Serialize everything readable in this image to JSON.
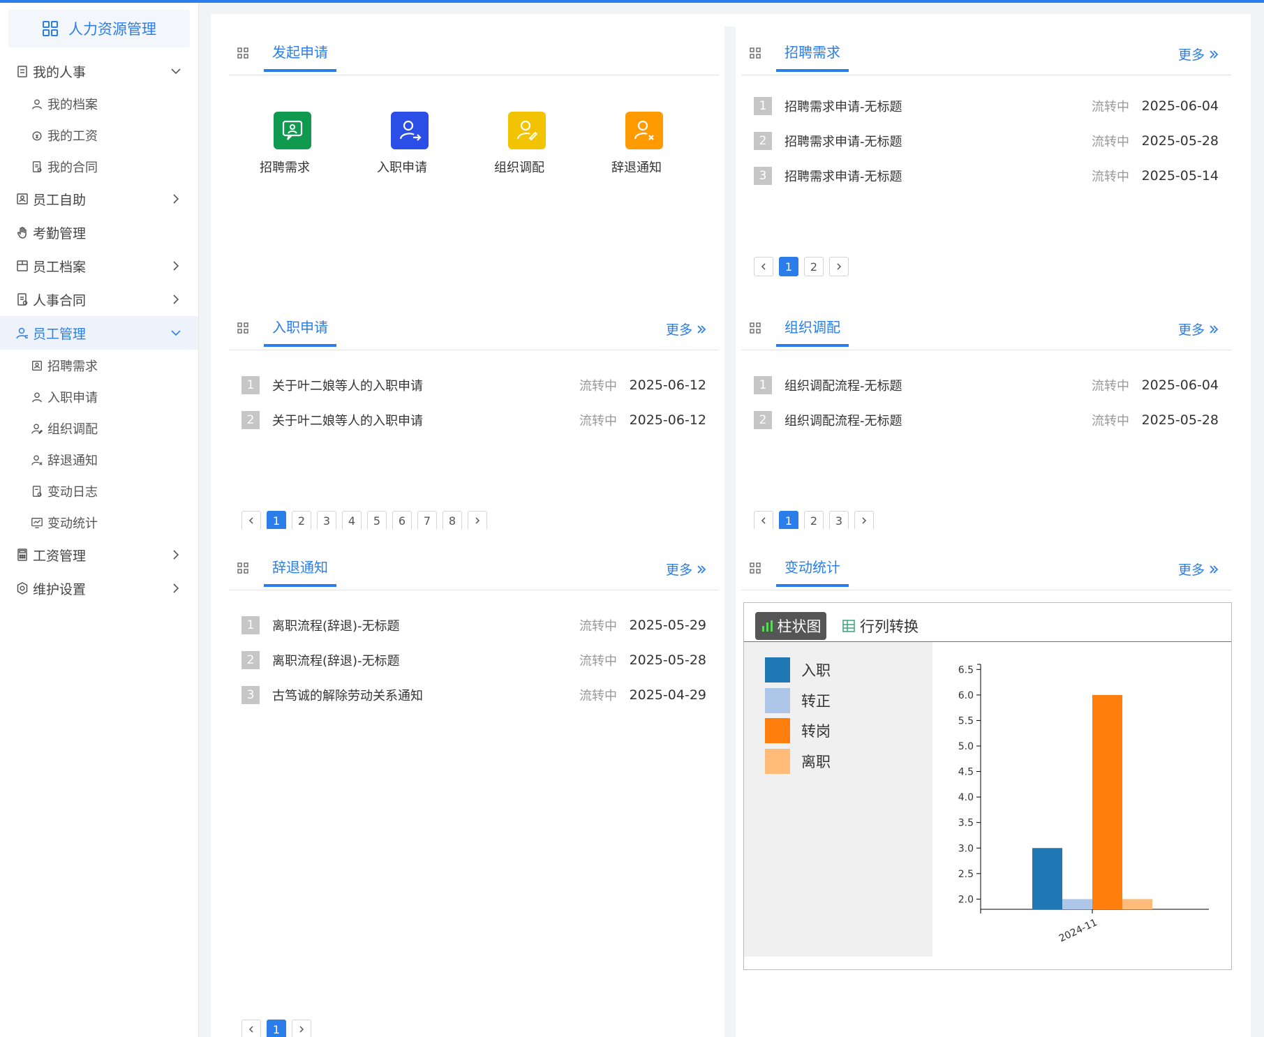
{
  "app": {
    "title": "人力资源管理"
  },
  "colors": {
    "accent": "#2b7de9",
    "green": "#0f9a4f",
    "blue": "#2b4fe6",
    "yellow": "#f2c300",
    "orange": "#ff9b00"
  },
  "sidebar": {
    "items": [
      {
        "label": "我的人事",
        "icon": "clipboard-icon",
        "expanded": true,
        "children": [
          {
            "label": "我的档案",
            "icon": "user-icon"
          },
          {
            "label": "我的工资",
            "icon": "money-icon"
          },
          {
            "label": "我的合同",
            "icon": "contract-icon"
          }
        ]
      },
      {
        "label": "员工自助",
        "icon": "id-card-icon",
        "arrow": "right"
      },
      {
        "label": "考勤管理",
        "icon": "hand-icon"
      },
      {
        "label": "员工档案",
        "icon": "archive-icon",
        "arrow": "right"
      },
      {
        "label": "人事合同",
        "icon": "contract-icon",
        "arrow": "right"
      },
      {
        "label": "员工管理",
        "icon": "user-manage-icon",
        "expanded": true,
        "active": true,
        "children": [
          {
            "label": "招聘需求",
            "icon": "id-card-icon"
          },
          {
            "label": "入职申请",
            "icon": "user-icon"
          },
          {
            "label": "组织调配",
            "icon": "user-edit-icon"
          },
          {
            "label": "辞退通知",
            "icon": "user-remove-icon"
          },
          {
            "label": "变动日志",
            "icon": "log-icon"
          },
          {
            "label": "变动统计",
            "icon": "stats-icon"
          }
        ]
      },
      {
        "label": "工资管理",
        "icon": "calculator-icon",
        "arrow": "right"
      },
      {
        "label": "维护设置",
        "icon": "settings-icon",
        "arrow": "right"
      }
    ]
  },
  "panels": {
    "launch": {
      "title": "发起申请",
      "actions": [
        {
          "label": "招聘需求",
          "icon": "recruit-icon",
          "color": "#0f9a4f"
        },
        {
          "label": "入职申请",
          "icon": "onboard-icon",
          "color": "#2b4fe6"
        },
        {
          "label": "组织调配",
          "icon": "transfer-icon",
          "color": "#f2c300"
        },
        {
          "label": "辞退通知",
          "icon": "dismiss-icon",
          "color": "#ff9b00"
        }
      ]
    },
    "recruit": {
      "title": "招聘需求",
      "more": "更多",
      "rows": [
        {
          "idx": "1",
          "title": "招聘需求申请-无标题",
          "status": "流转中",
          "date": "2025-06-04"
        },
        {
          "idx": "2",
          "title": "招聘需求申请-无标题",
          "status": "流转中",
          "date": "2025-05-28"
        },
        {
          "idx": "3",
          "title": "招聘需求申请-无标题",
          "status": "流转中",
          "date": "2025-05-14"
        }
      ],
      "pages": [
        "1",
        "2"
      ],
      "current_page": "1"
    },
    "onboard": {
      "title": "入职申请",
      "more": "更多",
      "rows": [
        {
          "idx": "1",
          "title": "关于叶二娘等人的入职申请",
          "status": "流转中",
          "date": "2025-06-12"
        },
        {
          "idx": "2",
          "title": "关于叶二娘等人的入职申请",
          "status": "流转中",
          "date": "2025-06-12"
        }
      ],
      "pages": [
        "1",
        "2",
        "3",
        "4",
        "5",
        "6",
        "7",
        "8"
      ],
      "current_page": "1"
    },
    "transfer": {
      "title": "组织调配",
      "more": "更多",
      "rows": [
        {
          "idx": "1",
          "title": "组织调配流程-无标题",
          "status": "流转中",
          "date": "2025-06-04"
        },
        {
          "idx": "2",
          "title": "组织调配流程-无标题",
          "status": "流转中",
          "date": "2025-05-28"
        }
      ],
      "pages": [
        "1",
        "2",
        "3"
      ],
      "current_page": "1"
    },
    "dismiss": {
      "title": "辞退通知",
      "more": "更多",
      "rows": [
        {
          "idx": "1",
          "title": "离职流程(辞退)-无标题",
          "status": "流转中",
          "date": "2025-05-29"
        },
        {
          "idx": "2",
          "title": "离职流程(辞退)-无标题",
          "status": "流转中",
          "date": "2025-05-28"
        },
        {
          "idx": "3",
          "title": "古笃诚的解除劳动关系通知",
          "status": "流转中",
          "date": "2025-04-29"
        }
      ],
      "pages": [
        "1"
      ],
      "current_page": "1"
    },
    "stats": {
      "title": "变动统计",
      "more": "更多",
      "tab_bar": "柱状图",
      "tab_swap": "行列转换"
    }
  },
  "chart_data": {
    "type": "bar",
    "categories": [
      "2024-11"
    ],
    "series": [
      {
        "name": "入职",
        "values": [
          3
        ],
        "color": "#1f77b4"
      },
      {
        "name": "转正",
        "values": [
          2
        ],
        "color": "#aec7e8"
      },
      {
        "name": "转岗",
        "values": [
          6
        ],
        "color": "#ff7f0e"
      },
      {
        "name": "离职",
        "values": [
          2
        ],
        "color": "#ffbb78"
      }
    ],
    "ylim": [
      1.8,
      6.6
    ],
    "yticks": [
      "2.0",
      "2.5",
      "3.0",
      "3.5",
      "4.0",
      "4.5",
      "5.0",
      "5.5",
      "6.0",
      "6.5"
    ],
    "legend": "left"
  }
}
